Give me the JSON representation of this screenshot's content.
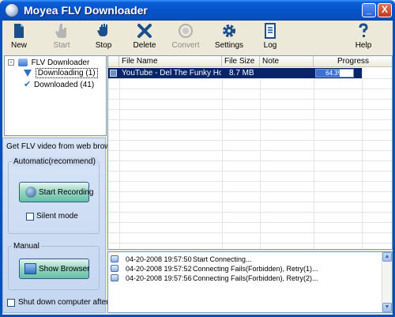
{
  "window": {
    "title": "Moyea FLV Downloader",
    "minimize_glyph": "_",
    "close_glyph": "X"
  },
  "toolbar": {
    "new": "New",
    "start": "Start",
    "stop": "Stop",
    "delete": "Delete",
    "convert": "Convert",
    "settings": "Settings",
    "log": "Log",
    "help": "Help"
  },
  "tree": {
    "root": "FLV Downloader",
    "items": [
      {
        "label": "Downloading (1)"
      },
      {
        "label": "Downloaded (41)"
      }
    ]
  },
  "side": {
    "heading": "Get FLV video from web browser",
    "auto_group": "Automatic(recommend)",
    "start_recording": "Start Recording",
    "silent_mode": "Silent mode",
    "manual_group": "Manual",
    "show_browser": "Show Browser",
    "shutdown": "Shut down computer after finish"
  },
  "list": {
    "columns": [
      "File Name",
      "File Size",
      "Note",
      "Progress"
    ],
    "rows": [
      {
        "file_name": "YouTube - Del The Funky Homosapie...",
        "file_size": "8.7 MB",
        "note": "",
        "progress_text": "64.3%",
        "progress_value": 0.643
      }
    ]
  },
  "log": {
    "entries": [
      {
        "time": "04-20-2008 19:57:50",
        "message": "Start Connecting..."
      },
      {
        "time": "04-20-2008 19:57:52",
        "message": "Connecting Fails(Forbidden), Retry(1)..."
      },
      {
        "time": "04-20-2008 19:57:56",
        "message": "Connecting Fails(Forbidden), Retry(2)..."
      }
    ]
  },
  "colors": {
    "titlebar": "#0553c8",
    "selection": "#0a246a",
    "progress": "#3a6fd8",
    "panel": "#c5d6f0"
  }
}
